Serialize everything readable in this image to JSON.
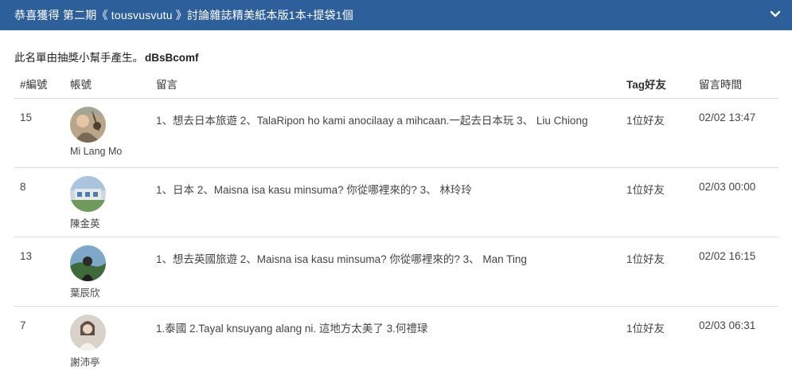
{
  "header": {
    "title": "恭喜獲得 第二期《 tousvusvutu 》討論雜誌精美紙本版1本+提袋1個"
  },
  "subtitle": {
    "text": "此名單由抽獎小幫手產生。",
    "code": "dBsBcomf"
  },
  "columns": {
    "num": "#編號",
    "account": "帳號",
    "message": "留言",
    "tag": "Tag好友",
    "time": "留言時間"
  },
  "rows": [
    {
      "num": "15",
      "name": "Mi Lang Mo",
      "message": "1、想去日本旅遊 2、TalaRipon ho kami anocilaay a mihcaan.一起去日本玩 3、 Liu Chiong",
      "tag": "1位好友",
      "time": "02/02 13:47"
    },
    {
      "num": "8",
      "name": "陳金英",
      "message": "1、日本 2、Maisna isa kasu minsuma? 你從哪裡來的? 3、 林玲玲",
      "tag": "1位好友",
      "time": "02/03 00:00"
    },
    {
      "num": "13",
      "name": "葉辰欣",
      "message": "1、想去英國旅遊 2、Maisna isa kasu minsuma? 你從哪裡來的? 3、 Man Ting",
      "tag": "1位好友",
      "time": "02/02 16:15"
    },
    {
      "num": "7",
      "name": "謝沛亭",
      "message": "1.泰國 2.Tayal knsuyang alang ni. 這地方太美了 3.何禮琭",
      "tag": "1位好友",
      "time": "02/03 06:31"
    }
  ]
}
